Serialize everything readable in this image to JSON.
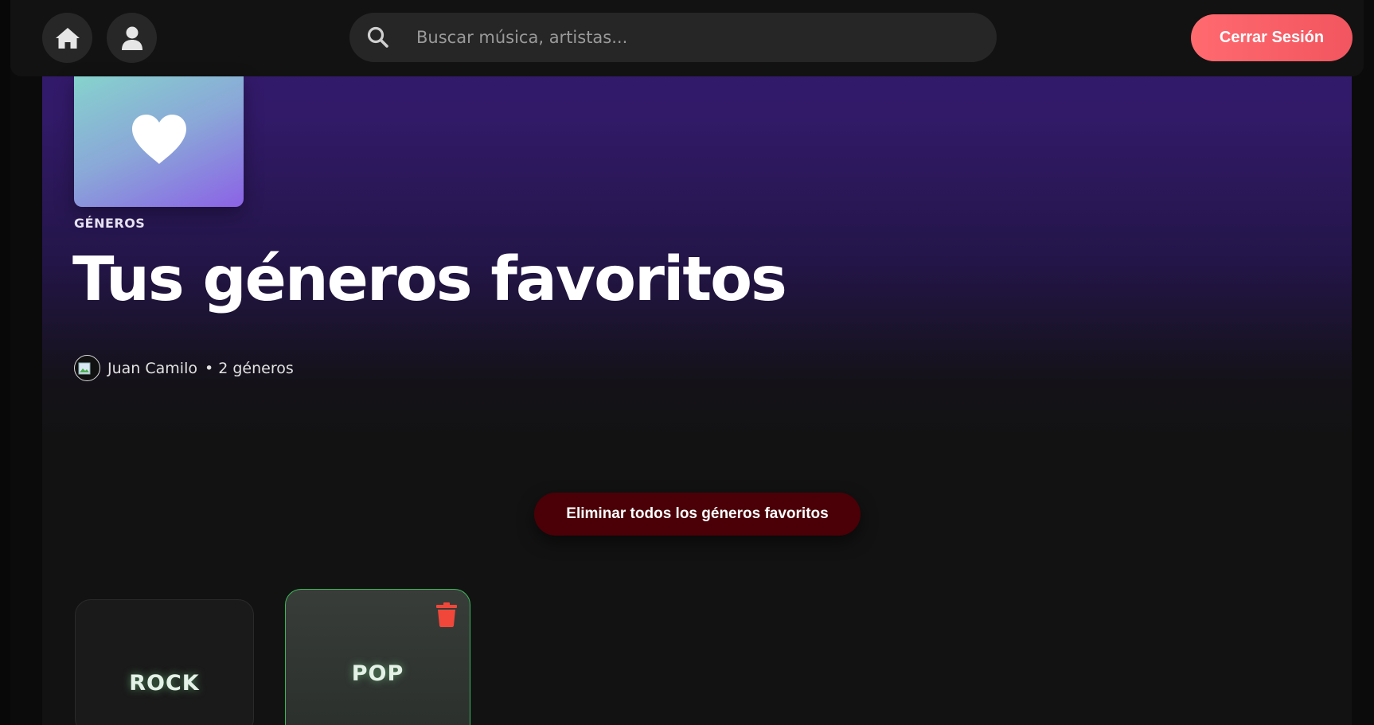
{
  "topbar": {
    "home_icon": "home-icon",
    "profile_icon": "user-icon",
    "search": {
      "placeholder": "Buscar música, artistas...",
      "value": "",
      "icon": "search-icon"
    },
    "logout_label": "Cerrar Sesión",
    "logout_color": "#ff6a6f"
  },
  "header": {
    "cover_icon": "heart-icon",
    "eyebrow": "GÉNEROS",
    "title": "Tus géneros favoritos",
    "owner": "Juan Camilo",
    "count": "• 2 géneros",
    "accent": "#34196d"
  },
  "actions": {
    "delete_all_label": "Eliminar todos los géneros favoritos"
  },
  "genres": [
    {
      "name": "ROCK",
      "selected": false
    },
    {
      "name": "POP",
      "selected": true,
      "action_icon": "trash-icon",
      "action_color": "#f0473a"
    }
  ]
}
